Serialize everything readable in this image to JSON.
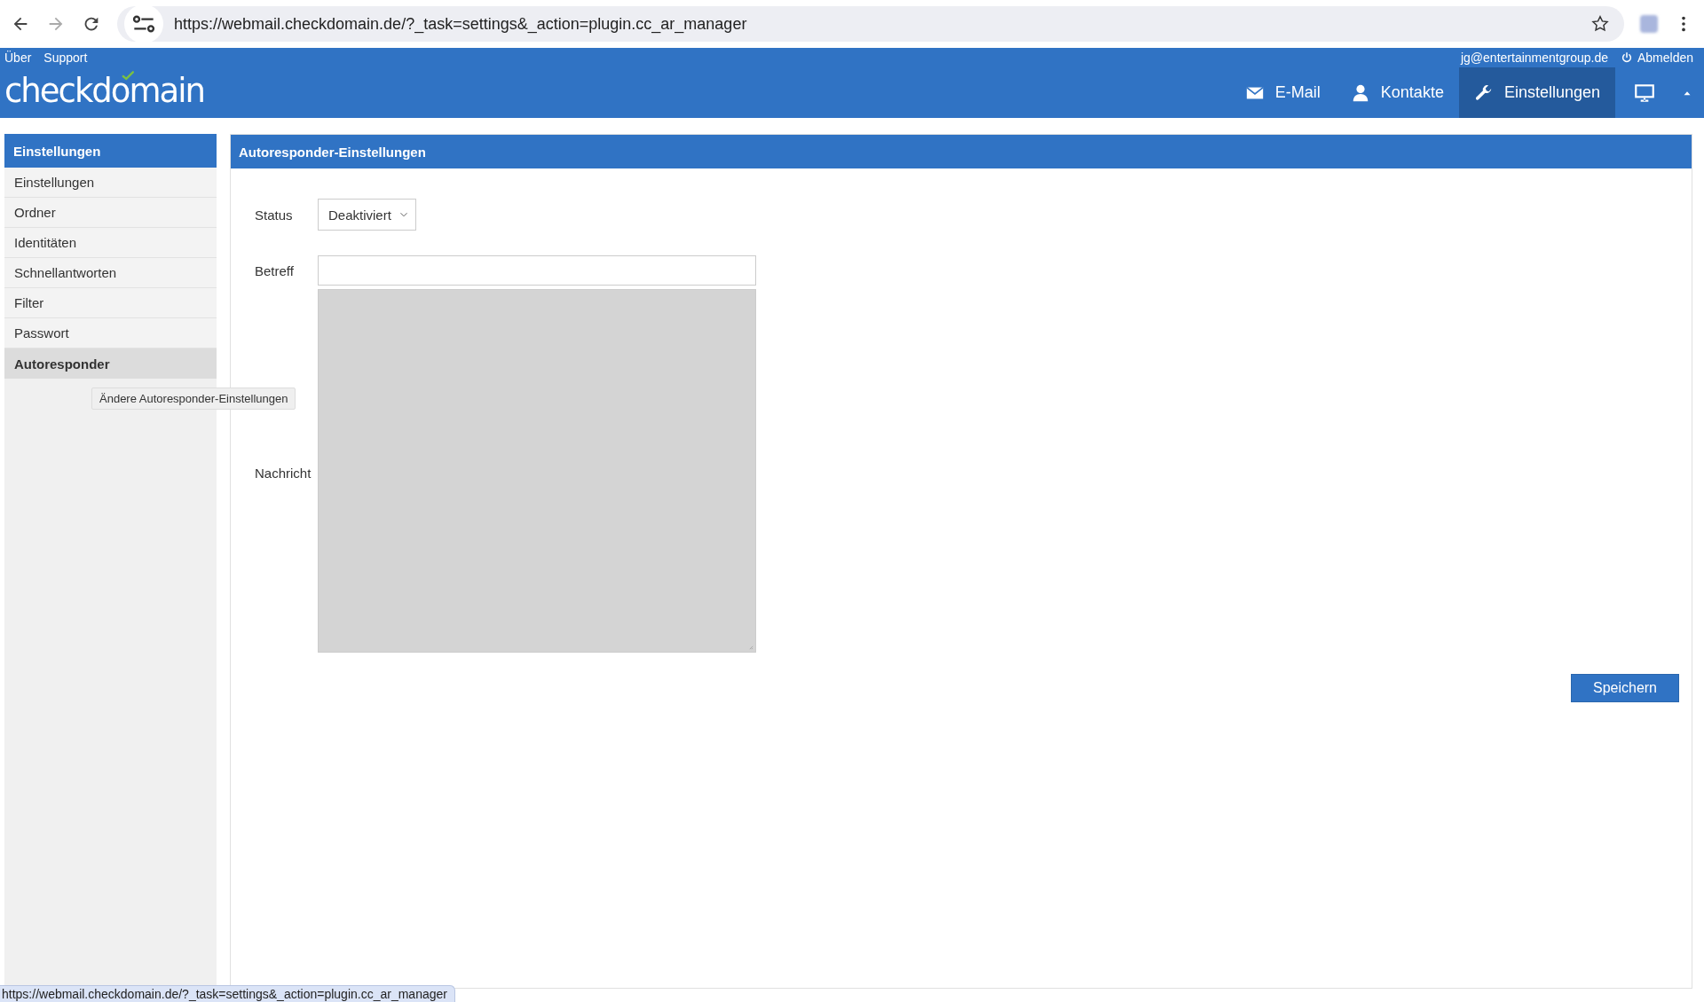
{
  "browser": {
    "url": "https://webmail.checkdomain.de/?_task=settings&_action=plugin.cc_ar_manager"
  },
  "header": {
    "links": [
      "Über",
      "Support"
    ],
    "user": "jg@entertainmentgroup.de",
    "logout": "Abmelden",
    "logo": "checkdomain",
    "nav": [
      {
        "kind": "mail",
        "label": "E-Mail",
        "selected": false
      },
      {
        "kind": "contacts",
        "label": "Kontakte",
        "selected": false
      },
      {
        "kind": "settings",
        "label": "Einstellungen",
        "selected": true
      }
    ]
  },
  "sidebar": {
    "title": "Einstellungen",
    "items": [
      {
        "label": "Einstellungen",
        "selected": false
      },
      {
        "label": "Ordner",
        "selected": false
      },
      {
        "label": "Identitäten",
        "selected": false
      },
      {
        "label": "Schnellantworten",
        "selected": false
      },
      {
        "label": "Filter",
        "selected": false
      },
      {
        "label": "Passwort",
        "selected": false
      },
      {
        "label": "Autoresponder",
        "selected": true
      }
    ],
    "tooltip": "Ändere Autoresponder-Einstellungen"
  },
  "panel": {
    "title": "Autoresponder-Einstellungen",
    "fields": [
      {
        "kind": "select",
        "label": "Status",
        "value": "Deaktiviert"
      },
      {
        "kind": "text",
        "label": "Betreff"
      },
      {
        "kind": "textarea",
        "label": "Nachricht"
      }
    ],
    "button": "Speichern"
  },
  "status_bar": {
    "text": "https://webmail.checkdomain.de/?_task=settings&_action=plugin.cc_ar_manager"
  }
}
